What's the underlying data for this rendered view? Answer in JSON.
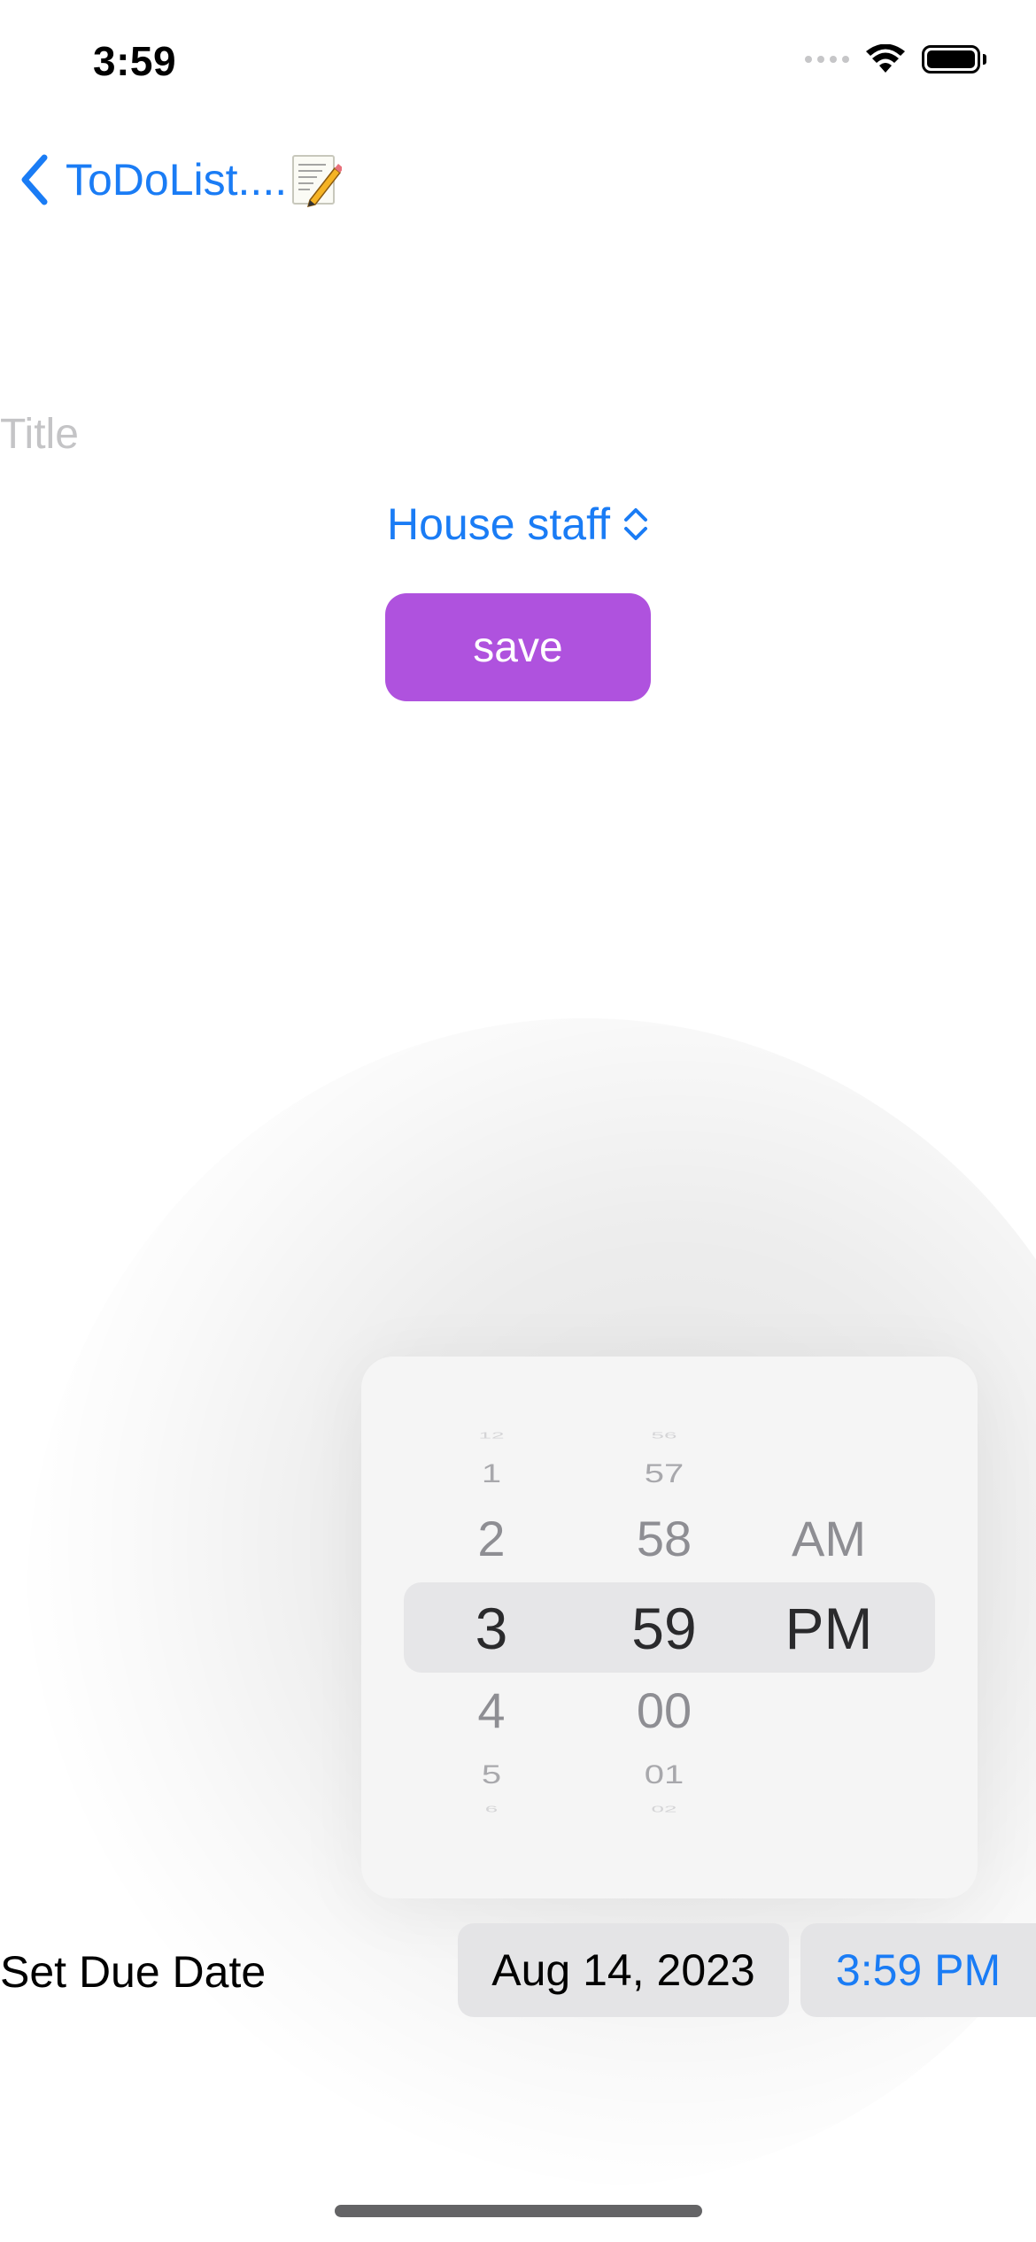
{
  "status_bar": {
    "time": "3:59",
    "icons": [
      "cellular-signal-icon",
      "wifi-icon",
      "battery-icon"
    ]
  },
  "nav": {
    "back_label": "ToDoList....",
    "back_icon": "chevron-left-icon",
    "title_emoji_icon": "memo-icon"
  },
  "form": {
    "title_placeholder": "Title",
    "title_value": "",
    "category": {
      "selected": "House staff",
      "icon": "chevron-up-down-icon"
    },
    "save_label": "save"
  },
  "time_picker": {
    "hours": [
      "12",
      "1",
      "2",
      "3",
      "4",
      "5",
      "6"
    ],
    "minutes": [
      "56",
      "57",
      "58",
      "59",
      "00",
      "01",
      "02"
    ],
    "periods": [
      "AM",
      "PM"
    ],
    "selected": {
      "hour": "3",
      "minute": "59",
      "period": "PM"
    }
  },
  "due_date": {
    "label": "Set Due Date",
    "date": "Aug 14, 2023",
    "time": "3:59 PM"
  },
  "colors": {
    "accent_blue": "#1a7cf5",
    "save_purple": "#af52de",
    "placeholder_gray": "#c4c4c6",
    "chip_gray": "#e4e4e6"
  }
}
